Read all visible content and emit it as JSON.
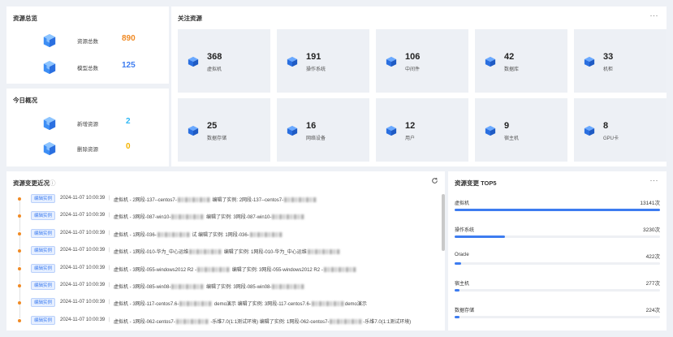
{
  "overview": {
    "title": "资源总览",
    "items": [
      {
        "label": "资源总数",
        "value": "890",
        "color": "#f08a24"
      },
      {
        "label": "模型总数",
        "value": "125",
        "color": "#3d7cf0"
      }
    ]
  },
  "today": {
    "title": "今日概况",
    "items": [
      {
        "label": "新增资源",
        "value": "2",
        "color": "#2db7f5"
      },
      {
        "label": "删除资源",
        "value": "0",
        "color": "#f5b400"
      }
    ]
  },
  "focus": {
    "title": "关注资源",
    "more": "···",
    "items": [
      {
        "value": "368",
        "label": "虚拟机",
        "icon": "cube-icon"
      },
      {
        "value": "191",
        "label": "操作系统",
        "icon": "cube-icon"
      },
      {
        "value": "106",
        "label": "中间件",
        "icon": "cube-icon"
      },
      {
        "value": "42",
        "label": "数据库",
        "icon": "cube-icon"
      },
      {
        "value": "33",
        "label": "机柜",
        "icon": "cube-icon"
      },
      {
        "value": "25",
        "label": "数据存储",
        "icon": "cube-icon"
      },
      {
        "value": "16",
        "label": "网络设备",
        "icon": "cube-icon"
      },
      {
        "value": "12",
        "label": "用户",
        "icon": "cube-icon"
      },
      {
        "value": "9",
        "label": "宿主机",
        "icon": "cube-icon"
      },
      {
        "value": "8",
        "label": "GPU卡",
        "icon": "cube-icon"
      }
    ]
  },
  "changes": {
    "title": "资源变更近况",
    "info_icon": "ⓘ",
    "refresh_icon": "refresh-icon",
    "rows": [
      {
        "tag": "编辑实例",
        "time": "2024-11-07 10:00:39",
        "sep": "|",
        "a": "虚拟机 - 2网段-137--centos7-",
        "b": "编辑了实例: 2网段-137--centos7-",
        "c": ""
      },
      {
        "tag": "编辑实例",
        "time": "2024-11-07 10:00:39",
        "sep": "|",
        "a": "虚拟机 - 3网段-087-win10-",
        "b": "编辑了实例: 3网段-087-win10-",
        "c": ""
      },
      {
        "tag": "编辑实例",
        "time": "2024-11-07 10:00:39",
        "sep": "|",
        "a": "虚拟机 - 1网段-036-",
        "b": "试 编辑了实例: 1网段-036-",
        "c": ""
      },
      {
        "tag": "编辑实例",
        "time": "2024-11-07 10:00:39",
        "sep": "|",
        "a": "虚拟机 - 1网段-010-华为_中心运维",
        "b": "编辑了实例: 1网段-010-华为_中心运维",
        "c": ""
      },
      {
        "tag": "编辑实例",
        "time": "2024-11-07 10:00:39",
        "sep": "|",
        "a": "虚拟机 - 3网段-055-windows2012 R2 -",
        "b": "编辑了实例: 3网段-055-windows2012 R2 -",
        "c": ""
      },
      {
        "tag": "编辑实例",
        "time": "2024-11-07 10:00:39",
        "sep": "|",
        "a": "虚拟机 - 3网段-085-win08-",
        "b": "编辑了实例: 3网段-085-win08-",
        "c": ""
      },
      {
        "tag": "编辑实例",
        "time": "2024-11-07 10:00:39",
        "sep": "|",
        "a": "虚拟机 - 3网段-117-centos7.6-",
        "b": "demo演示 编辑了实例: 3网段-117-centos7.6-",
        "c": "demo演示"
      },
      {
        "tag": "编辑实例",
        "time": "2024-11-07 10:00:39",
        "sep": "|",
        "a": "虚拟机 - 1网段-062-centos7-",
        "b": "-乐维7.0(1:1测试环境) 编辑了实例: 1网段-062-centos7-",
        "c": "-乐维7.0(1:1测试环境)"
      }
    ]
  },
  "tops": {
    "title": "资源变更 TOP5",
    "more": "···",
    "items": [
      {
        "name": "虚拟机",
        "count": 13141,
        "label": "13141次"
      },
      {
        "name": "操作系统",
        "count": 3230,
        "label": "3230次"
      },
      {
        "name": "Oracle",
        "count": 422,
        "label": "422次"
      },
      {
        "name": "宿主机",
        "count": 277,
        "label": "277次"
      },
      {
        "name": "数据存储",
        "count": 224,
        "label": "224次"
      }
    ]
  },
  "colors": {
    "accent": "#3d7cf0",
    "orange": "#f08a24"
  }
}
